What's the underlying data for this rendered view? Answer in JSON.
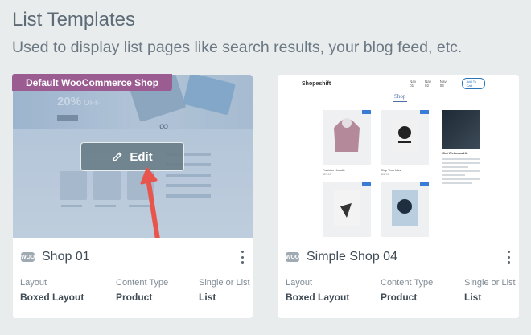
{
  "header": {
    "title": "List Templates",
    "subtitle": "Used to display list pages like search results, your blog feed, etc."
  },
  "cards": [
    {
      "badge": "Default WooCommerce Shop",
      "edit_label": "Edit",
      "icon_text": "WOO",
      "name": "Shop 01",
      "meta": [
        {
          "label": "Layout",
          "value": "Boxed Layout"
        },
        {
          "label": "Content Type",
          "value": "Product"
        },
        {
          "label": "Single or List",
          "value": "List"
        }
      ],
      "preview": {
        "hero_percent": "20%",
        "hero_suffix": "OFF"
      }
    },
    {
      "icon_text": "WOO",
      "name": "Simple Shop 04",
      "meta": [
        {
          "label": "Layout",
          "value": "Boxed Layout"
        },
        {
          "label": "Content Type",
          "value": "Product"
        },
        {
          "label": "Single or List",
          "value": "List"
        }
      ],
      "preview": {
        "logo": "Shopeshift",
        "links": [
          "Nav 01",
          "Nav 02",
          "Nav 03"
        ],
        "cart": "Add To Cart",
        "heading": "Shop",
        "items": [
          {
            "name": "Fashion Hoodie",
            "price": "$29.00"
          },
          {
            "name": "Ship Your Idea",
            "price": "$22.00"
          }
        ],
        "side_heading": "Get Wellness Kit"
      }
    }
  ],
  "colors": {
    "background": "#e9eced",
    "badge": "#9b5c91",
    "arrow": "#e8554d",
    "accent": "#3a7bd5"
  }
}
